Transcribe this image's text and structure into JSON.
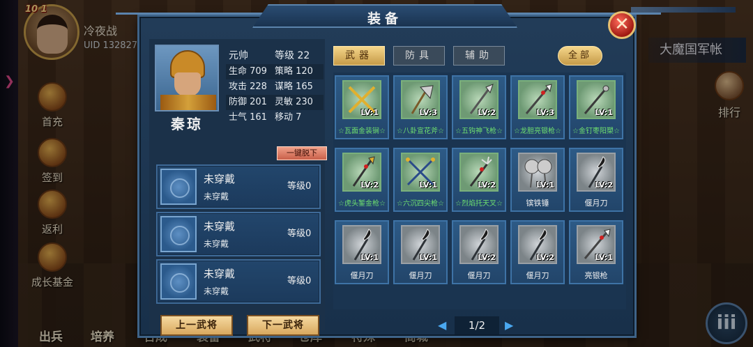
{
  "player": {
    "level_badge": "10 1",
    "name": "冷夜战",
    "uid": "UID 132827"
  },
  "sidebar": {
    "items": [
      {
        "label": "首充",
        "icon": "first-charge-icon"
      },
      {
        "label": "签到",
        "icon": "sign-in-icon"
      },
      {
        "label": "返利",
        "icon": "rebate-icon"
      },
      {
        "label": "成长基金",
        "icon": "growth-fund-icon"
      }
    ]
  },
  "scene": {
    "location_title": "大魔国军帐",
    "rank_label": "排行"
  },
  "bottom_nav": {
    "items": [
      "出兵",
      "培养",
      "合成",
      "装备",
      "武将",
      "仓库",
      "特殊",
      "商城"
    ],
    "menu_glyph": "iii"
  },
  "dialog": {
    "title": "装备",
    "close_glyph": "✕"
  },
  "hero": {
    "name": "秦琼",
    "title": "元帅",
    "level": "等级 22",
    "stats": [
      [
        "生命 709",
        "策略 120"
      ],
      [
        "攻击 228",
        "谋略 165"
      ],
      [
        "防御 201",
        "灵敏 230"
      ],
      [
        "士气 161",
        "移动 7"
      ]
    ],
    "remove_all_label": "一键脱下",
    "prev_label": "上一武将",
    "next_label": "下一武将"
  },
  "slots": [
    {
      "name": "未穿戴",
      "sub": "未穿戴",
      "level": "等级0"
    },
    {
      "name": "未穿戴",
      "sub": "未穿戴",
      "level": "等级0"
    },
    {
      "name": "未穿戴",
      "sub": "未穿戴",
      "level": "等级0"
    }
  ],
  "tabs": {
    "weapon": "武器",
    "armor": "防具",
    "aux": "辅助",
    "all": "全部"
  },
  "items": [
    {
      "name": "☆瓦面金装锏☆",
      "lv": "LV:1",
      "quality": "green",
      "icon": "twin-maces-icon"
    },
    {
      "name": "☆八卦宣花斧☆",
      "lv": "LV:3",
      "quality": "green",
      "icon": "battle-axe-icon"
    },
    {
      "name": "☆五钩神飞枪☆",
      "lv": "LV:2",
      "quality": "green",
      "icon": "hook-spear-icon"
    },
    {
      "name": "☆龙胆亮银枪☆",
      "lv": "LV:3",
      "quality": "green",
      "icon": "silver-spear-icon"
    },
    {
      "name": "☆金钉枣阳槊☆",
      "lv": "LV:1",
      "quality": "green",
      "icon": "mace-spear-icon"
    },
    {
      "name": "☆虎头錾金枪☆",
      "lv": "LV:2",
      "quality": "green",
      "icon": "gold-spear-icon"
    },
    {
      "name": "☆六沉四尖枪☆",
      "lv": "LV:1",
      "quality": "green",
      "icon": "crossed-spears-icon"
    },
    {
      "name": "☆烈焰托天叉☆",
      "lv": "LV:2",
      "quality": "green",
      "icon": "trident-icon"
    },
    {
      "name": "镔铁锤",
      "lv": "LV:1",
      "quality": "white",
      "icon": "iron-hammer-icon"
    },
    {
      "name": "偃月刀",
      "lv": "LV:2",
      "quality": "white",
      "icon": "crescent-blade-icon"
    },
    {
      "name": "偃月刀",
      "lv": "LV:1",
      "quality": "white",
      "icon": "crescent-blade-icon"
    },
    {
      "name": "偃月刀",
      "lv": "LV:1",
      "quality": "white",
      "icon": "crescent-blade-icon"
    },
    {
      "name": "偃月刀",
      "lv": "LV:2",
      "quality": "white",
      "icon": "crescent-blade-icon"
    },
    {
      "name": "偃月刀",
      "lv": "LV:2",
      "quality": "white",
      "icon": "crescent-blade-icon"
    },
    {
      "name": "亮银枪",
      "lv": "LV:1",
      "quality": "white",
      "icon": "silver-spear-icon"
    }
  ],
  "pager": {
    "text": "1/2",
    "prev": "◀",
    "next": "▶"
  },
  "colors": {
    "green_quality": "#6fe06f",
    "white_quality": "#f0f0f0",
    "tab_active": "#c59a48"
  }
}
